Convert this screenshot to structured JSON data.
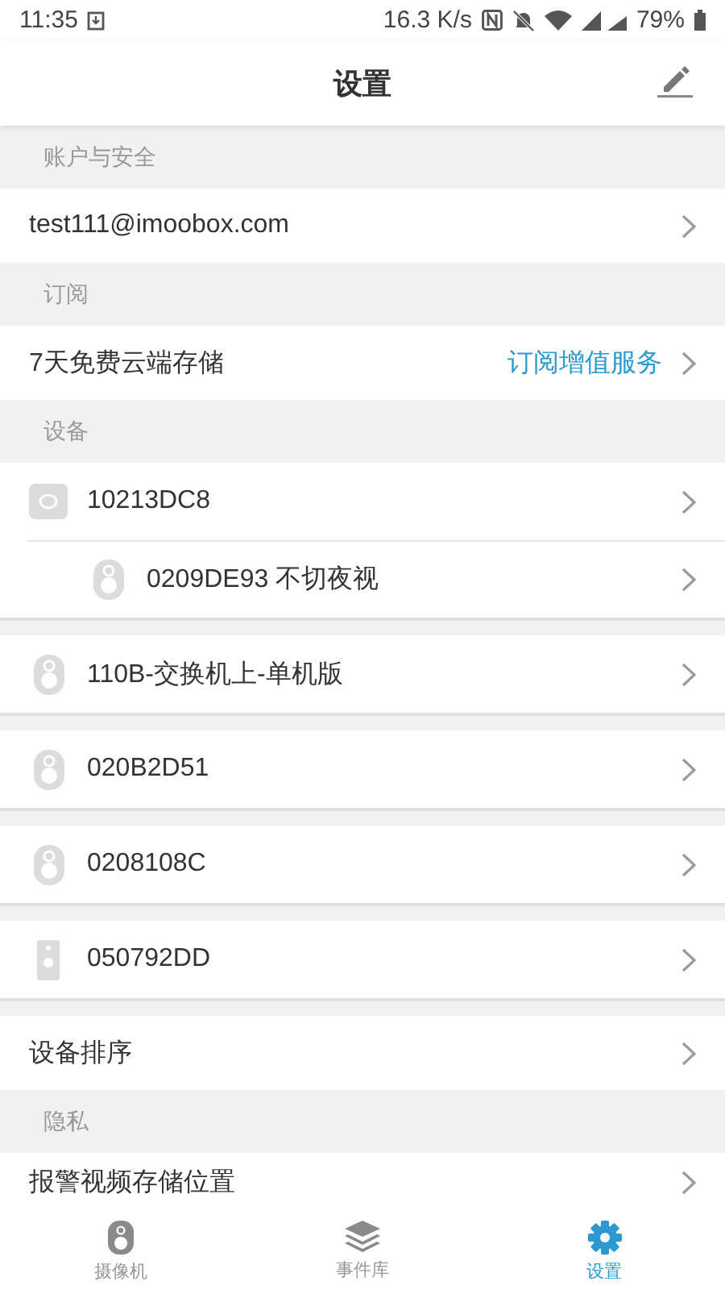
{
  "status_bar": {
    "time": "11:35",
    "speed": "16.3 K/s",
    "battery": "79%"
  },
  "header": {
    "title": "设置"
  },
  "account": {
    "header": "账户与安全",
    "email": "test111@imoobox.com"
  },
  "subscription": {
    "header": "订阅",
    "label": "7天免费云端存储",
    "link": "订阅增值服务"
  },
  "devices": {
    "header": "设备",
    "items": [
      {
        "name": "10213DC8",
        "kind": "hub",
        "children": [
          {
            "name": "0209DE93 不切夜视",
            "kind": "camera"
          }
        ]
      },
      {
        "name": "110B-交换机上-单机版",
        "kind": "camera"
      },
      {
        "name": "020B2D51",
        "kind": "camera"
      },
      {
        "name": "0208108C",
        "kind": "camera"
      },
      {
        "name": "050792DD",
        "kind": "doorbell"
      }
    ]
  },
  "device_sort": "设备排序",
  "privacy": {
    "header": "隐私",
    "rows": [
      "报警视频存储位置"
    ]
  },
  "tab_bar": [
    {
      "label": "摄像机",
      "kind": "camera",
      "selected": false
    },
    {
      "label": "事件库",
      "kind": "layers",
      "selected": false
    },
    {
      "label": "设置",
      "kind": "gear",
      "selected": true
    }
  ]
}
